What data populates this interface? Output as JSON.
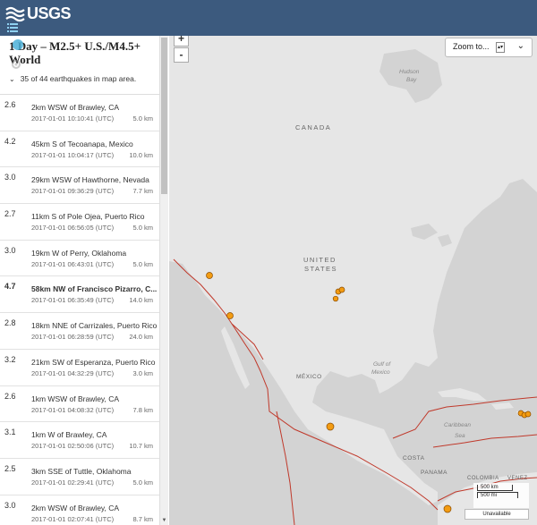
{
  "header": {
    "logo_text": "USGS"
  },
  "sidebar": {
    "title": "1 Day – M2.5+ U.S./M4.5+ World",
    "count_text": "35 of 44 earthquakes in map area."
  },
  "earthquakes": [
    {
      "mag": "2.6",
      "place": "2km WSW of Brawley, CA",
      "time": "2017-01-01 10:10:41 (UTC)",
      "depth": "5.0 km"
    },
    {
      "mag": "4.2",
      "place": "45km S of Tecoanapa, Mexico",
      "time": "2017-01-01 10:04:17 (UTC)",
      "depth": "10.0 km"
    },
    {
      "mag": "3.0",
      "place": "29km WSW of Hawthorne, Nevada",
      "time": "2017-01-01 09:36:29 (UTC)",
      "depth": "7.7 km"
    },
    {
      "mag": "2.7",
      "place": "11km S of Pole Ojea, Puerto Rico",
      "time": "2017-01-01 06:56:05 (UTC)",
      "depth": "5.0 km"
    },
    {
      "mag": "3.0",
      "place": "19km W of Perry, Oklahoma",
      "time": "2017-01-01 06:43:01 (UTC)",
      "depth": "5.0 km"
    },
    {
      "mag": "4.7",
      "place": "58km NW of Francisco Pizarro, C...",
      "time": "2017-01-01 06:35:49 (UTC)",
      "depth": "14.0 km"
    },
    {
      "mag": "2.8",
      "place": "18km NNE of Carrizales, Puerto Rico",
      "time": "2017-01-01 06:28:59 (UTC)",
      "depth": "24.0 km"
    },
    {
      "mag": "3.2",
      "place": "21km SW of Esperanza, Puerto Rico",
      "time": "2017-01-01 04:32:29 (UTC)",
      "depth": "3.0 km"
    },
    {
      "mag": "2.6",
      "place": "1km WSW of Brawley, CA",
      "time": "2017-01-01 04:08:32 (UTC)",
      "depth": "7.8 km"
    },
    {
      "mag": "3.1",
      "place": "1km W of Brawley, CA",
      "time": "2017-01-01 02:50:06 (UTC)",
      "depth": "10.7 km"
    },
    {
      "mag": "2.5",
      "place": "3km SSE of Tuttle, Oklahoma",
      "time": "2017-01-01 02:29:41 (UTC)",
      "depth": "5.0 km"
    },
    {
      "mag": "3.0",
      "place": "2km WSW of Brawley, CA",
      "time": "2017-01-01 02:07:41 (UTC)",
      "depth": "8.7 km"
    }
  ],
  "map": {
    "zoom_in": "+",
    "zoom_out": "-",
    "zoom_to_label": "Zoom to...",
    "labels": {
      "canada": "CANADA",
      "united": "UNITED",
      "states": "STATES",
      "mexico": "MÉXICO",
      "hudson": "Hudson",
      "bay": "Bay",
      "gulf": "Gulf of",
      "mexico_sea": "Mexico",
      "caribbean": "Caribbean",
      "sea": "Sea",
      "costa": "COSTA",
      "panama": "PANAMA",
      "colombia": "COLOMBIA",
      "venez": "VENEZ"
    },
    "scale_km": "500 km",
    "scale_mi": "500 mi",
    "unavailable": "Unavailable"
  },
  "colors": {
    "header": "#3c5a7e",
    "quake": "#f39c12",
    "plate": "#c0392b",
    "land": "#e6e6e6",
    "water": "#d2d2d2"
  }
}
